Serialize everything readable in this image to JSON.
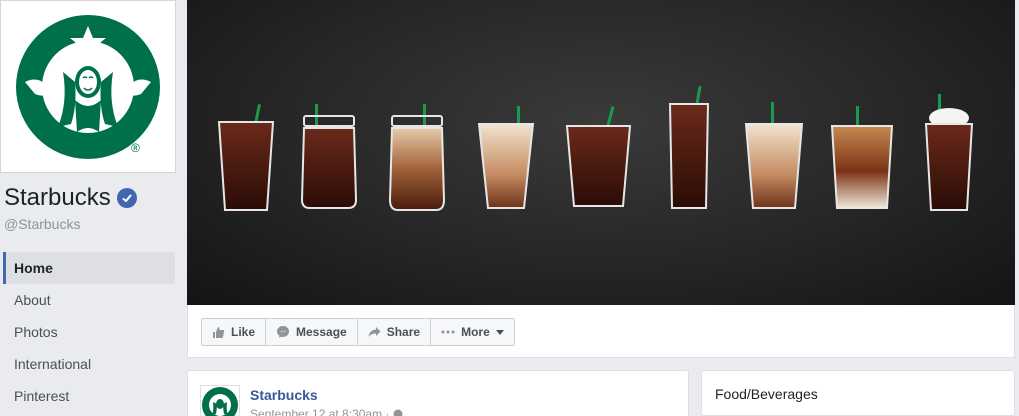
{
  "profile": {
    "name": "Starbucks",
    "handle": "@Starbucks",
    "logo_icon": "starbucks-siren-logo",
    "verified_icon": "verified-check-icon"
  },
  "nav": {
    "items": [
      {
        "label": "Home",
        "active": true
      },
      {
        "label": "About",
        "active": false
      },
      {
        "label": "Photos",
        "active": false
      },
      {
        "label": "International",
        "active": false
      },
      {
        "label": "Pinterest",
        "active": false
      }
    ]
  },
  "cover": {
    "description_icon": "iced-coffee-drinks-illustration"
  },
  "actions": {
    "like": "Like",
    "message": "Message",
    "share": "Share",
    "more": "More"
  },
  "post": {
    "author": "Starbucks",
    "date": "September 12 at 8:30am · "
  },
  "category": {
    "label": "Food/Beverages"
  },
  "colors": {
    "brand_green": "#00704a",
    "facebook_blue": "#4267b2",
    "link_blue": "#365899"
  }
}
